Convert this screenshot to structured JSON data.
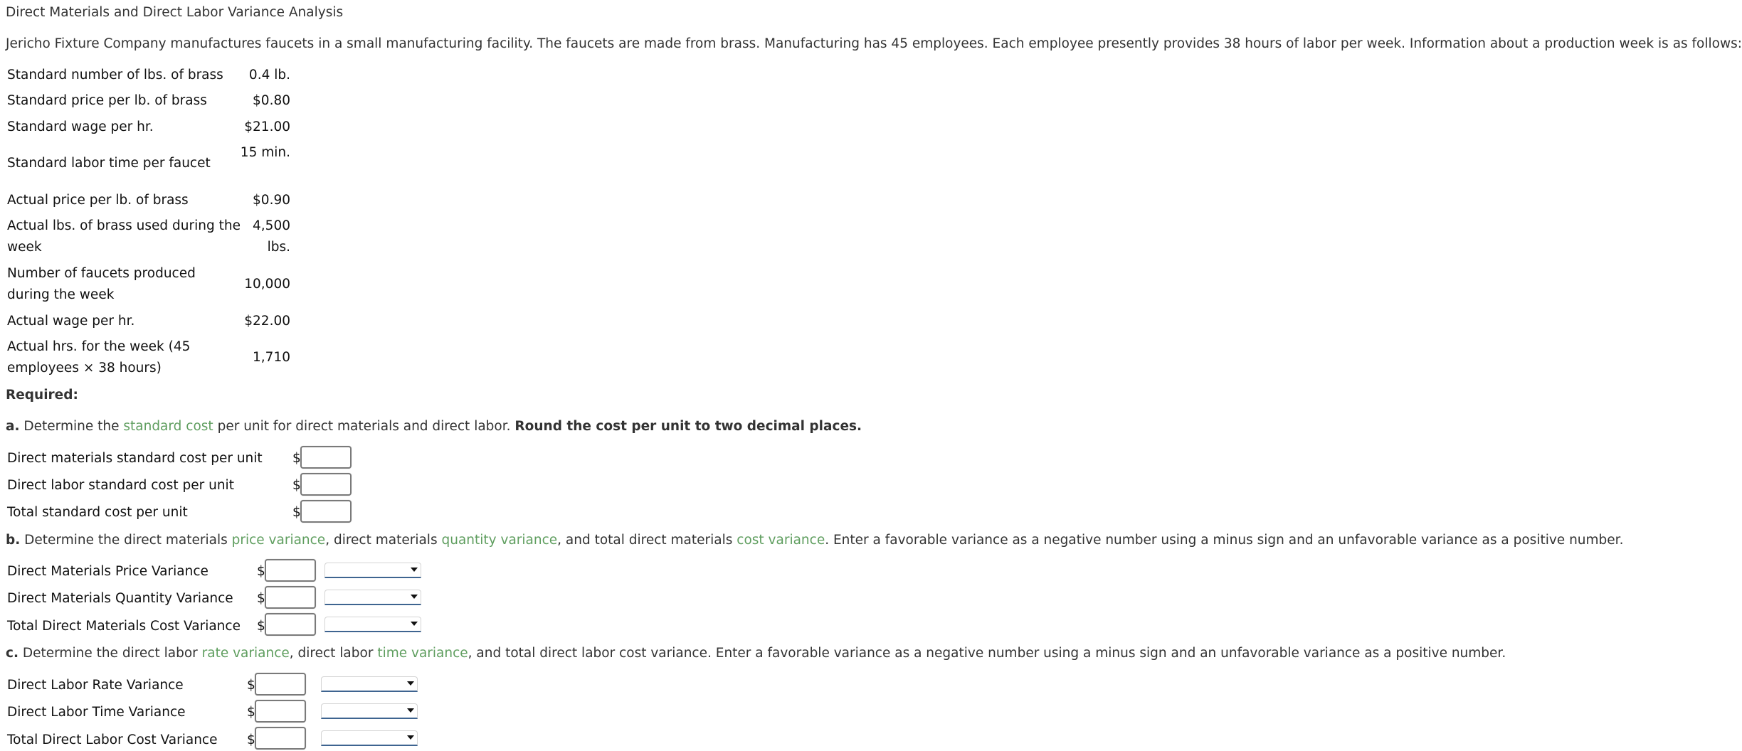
{
  "title": "Direct Materials and Direct Labor Variance Analysis",
  "intro": "Jericho Fixture Company manufactures faucets in a small manufacturing facility. The faucets are made from brass. Manufacturing has 45 employees. Each employee presently provides 38 hours of labor per week. Information about a production week is as follows:",
  "info_table": [
    {
      "label": "Standard number of lbs. of brass",
      "value": "0.4 lb."
    },
    {
      "label": "Standard price per lb. of brass",
      "value": "$0.80"
    },
    {
      "label": "Standard wage per hr.",
      "value": "$21.00"
    },
    {
      "label": "Standard labor time per faucet",
      "value": "15 min."
    },
    {
      "label": "Actual price per lb. of brass",
      "value": "$0.90"
    },
    {
      "label": "Actual lbs. of brass used during the week",
      "value": "4,500 lbs."
    },
    {
      "label": "Number of faucets produced during the week",
      "value": "10,000"
    },
    {
      "label": "Actual wage per hr.",
      "value": "$22.00"
    },
    {
      "label": "Actual hrs. for the week (45 employees × 38 hours)",
      "value": "1,710"
    }
  ],
  "required_label": "Required:",
  "part_a": {
    "letter": "a.",
    "text_1": "Determine the",
    "link_1": "standard cost",
    "text_2": "per unit for direct materials and direct labor.",
    "bold_instruction": "Round the cost per unit to two decimal places.",
    "rows": [
      {
        "label": "Direct materials standard cost per unit",
        "currency": "$",
        "value": ""
      },
      {
        "label": "Direct labor standard cost per unit",
        "currency": "$",
        "value": ""
      },
      {
        "label": "Total standard cost per unit",
        "currency": "$",
        "value": ""
      }
    ]
  },
  "part_b": {
    "letter": "b.",
    "text_1": "Determine the direct materials",
    "link_1": "price variance",
    "text_2": ", direct materials",
    "link_2": "quantity variance",
    "text_3": ", and total direct materials",
    "link_3": "cost variance",
    "text_4": ". Enter a favorable variance as a negative number using a minus sign and an unfavorable variance as a positive number.",
    "rows": [
      {
        "label": "Direct Materials Price Variance",
        "currency": "$",
        "value": "",
        "select_value": ""
      },
      {
        "label": "Direct Materials Quantity Variance",
        "currency": "$",
        "value": "",
        "select_value": ""
      },
      {
        "label": "Total Direct Materials Cost Variance",
        "currency": "$",
        "value": "",
        "select_value": ""
      }
    ]
  },
  "part_c": {
    "letter": "c.",
    "text_1": "Determine the direct labor",
    "link_1": "rate variance",
    "text_2": ", direct labor",
    "link_2": "time variance",
    "text_3": ", and total direct labor cost variance. Enter a favorable variance as a negative number using a minus sign and an unfavorable variance as a positive number.",
    "rows": [
      {
        "label": "Direct Labor Rate Variance",
        "currency": "$",
        "value": "",
        "select_value": ""
      },
      {
        "label": "Direct Labor Time Variance",
        "currency": "$",
        "value": "",
        "select_value": ""
      },
      {
        "label": "Total Direct Labor Cost Variance",
        "currency": "$",
        "value": "",
        "select_value": ""
      }
    ]
  },
  "icons": {
    "select_caret": "caret-down-icon"
  },
  "colors": {
    "link_green": "#5f9e5f",
    "text": "#333333",
    "select_underline": "#3e6490",
    "input_border": "#7a7a7a"
  }
}
